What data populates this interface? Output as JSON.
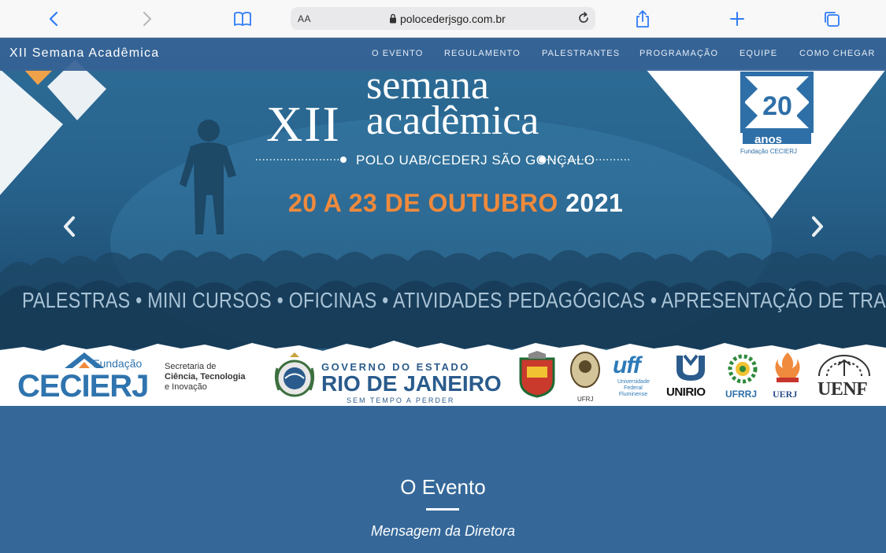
{
  "browser": {
    "text_size_label": "AA",
    "url": "polocederjsgo.com.br"
  },
  "navbar": {
    "brand": "XII Semana Acadêmica",
    "links": [
      "O EVENTO",
      "REGULAMENTO",
      "PALESTRANTES",
      "PROGRAMAÇÃO",
      "EQUIPE",
      "COMO CHEGAR"
    ]
  },
  "hero": {
    "title_roman": "XII",
    "title_line1": "semana",
    "title_line2": "acadêmica",
    "subtitle": "POLO UAB/CEDERJ SÃO GONÇALO",
    "dates": "20 A 23 DE OUTUBRO",
    "year": "2021",
    "activities": "PALESTRAS • MINI CURSOS • OFICINAS • ATIVIDADES PEDAGÓGICAS • APRESENTAÇÃO DE TRABALHOS",
    "badge": {
      "number": "20",
      "word": "anos",
      "org": "Fundação CECIERJ"
    }
  },
  "logos": {
    "fundacao": "Fundação",
    "cecierj": "CECIERJ",
    "secretaria_line1": "Secretaria de",
    "secretaria_line2": "Ciência, Tecnologia",
    "secretaria_line3": "e Inovação",
    "governo_top": "GOVERNO DO ESTADO",
    "governo_main": "RIO DE JANEIRO",
    "governo_slogan": "SEM TEMPO A PERDER",
    "ufrj": "UFRJ",
    "uff": "uff",
    "uff_sub1": "Universidade",
    "uff_sub2": "Federal",
    "uff_sub3": "Fluminense",
    "unirio": "UNIRIO",
    "ufrrj": "UFRRJ",
    "uerj": "UERJ",
    "uenf": "UENF"
  },
  "section": {
    "title": "O Evento",
    "subtitle": "Mensagem da Diretora"
  },
  "colors": {
    "navbar": "#366294",
    "section_bg": "#356899",
    "accent_orange": "#f08a3c",
    "cecierj_blue": "#2f74ae"
  }
}
